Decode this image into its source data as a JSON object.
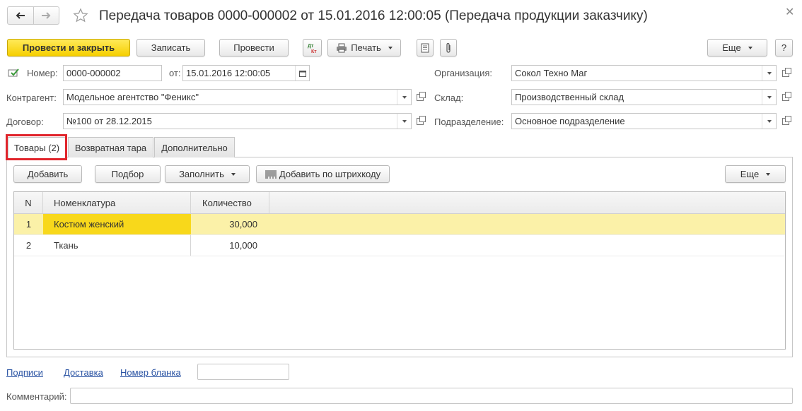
{
  "window": {
    "title": "Передача товаров 0000-000002 от 15.01.2016 12:00:05 (Передача продукции заказчику)"
  },
  "toolbar": {
    "post_close": "Провести и закрыть",
    "save": "Записать",
    "post": "Провести",
    "print": "Печать",
    "more": "Еще",
    "help": "?"
  },
  "form": {
    "number_label": "Номер:",
    "number_value": "0000-000002",
    "date_label": "от:",
    "date_value": "15.01.2016 12:00:05",
    "org_label": "Организация:",
    "org_value": "Сокол Техно Маг",
    "counterparty_label": "Контрагент:",
    "counterparty_value": "Модельное агентство \"Феникс\"",
    "warehouse_label": "Склад:",
    "warehouse_value": "Производственный склад",
    "contract_label": "Договор:",
    "contract_value": "№100 от 28.12.2015",
    "division_label": "Подразделение:",
    "division_value": "Основное подразделение"
  },
  "tabs": [
    {
      "label": "Товары (2)",
      "active": true
    },
    {
      "label": "Возвратная тара",
      "active": false
    },
    {
      "label": "Дополнительно",
      "active": false
    }
  ],
  "table_toolbar": {
    "add": "Добавить",
    "pick": "Подбор",
    "fill": "Заполнить",
    "add_barcode": "Добавить по штрихкоду",
    "more": "Еще"
  },
  "table": {
    "columns": [
      "N",
      "Номенклатура",
      "Количество"
    ],
    "rows": [
      {
        "n": "1",
        "name": "Костюм женский",
        "qty": "30,000"
      },
      {
        "n": "2",
        "name": "Ткань",
        "qty": "10,000"
      }
    ]
  },
  "footer": {
    "links": [
      "Подписи",
      "Доставка",
      "Номер бланка"
    ],
    "blank_number_value": "",
    "comment_label": "Комментарий:",
    "comment_value": ""
  },
  "colors": {
    "primary_button": "#f6cf00",
    "selected_row": "#fbf1a8",
    "selected_cell": "#f8d81b",
    "highlight": "#e0242b",
    "link": "#2a53a3"
  }
}
